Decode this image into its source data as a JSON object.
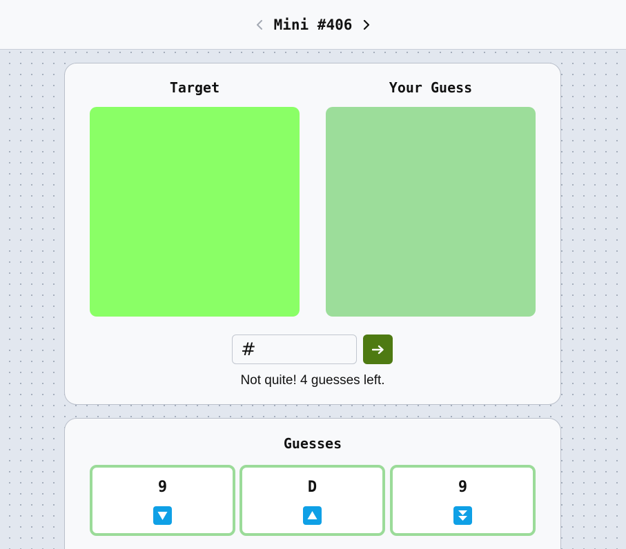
{
  "header": {
    "title": "Mini #406",
    "prev_icon": "chevron-left-icon",
    "next_icon": "chevron-right-icon"
  },
  "comparison": {
    "target_label": "Target",
    "guess_label": "Your Guess",
    "target_color": "#8aff66",
    "guess_color": "#9cdd9a"
  },
  "input": {
    "prefix": "#",
    "value": "",
    "placeholder": "",
    "submit_icon": "arrow-right-icon",
    "submit_color": "#4e7a12"
  },
  "status": {
    "message": "Not quite! 4 guesses left."
  },
  "guesses": {
    "title": "Guesses",
    "tile_border_color": "#9bdb99",
    "hint_color": "#0fa0e6",
    "items": [
      {
        "char": "9",
        "hint": "arrow-down-icon"
      },
      {
        "char": "D",
        "hint": "arrow-up-icon"
      },
      {
        "char": "9",
        "hint": "double-arrow-down-icon"
      }
    ]
  }
}
